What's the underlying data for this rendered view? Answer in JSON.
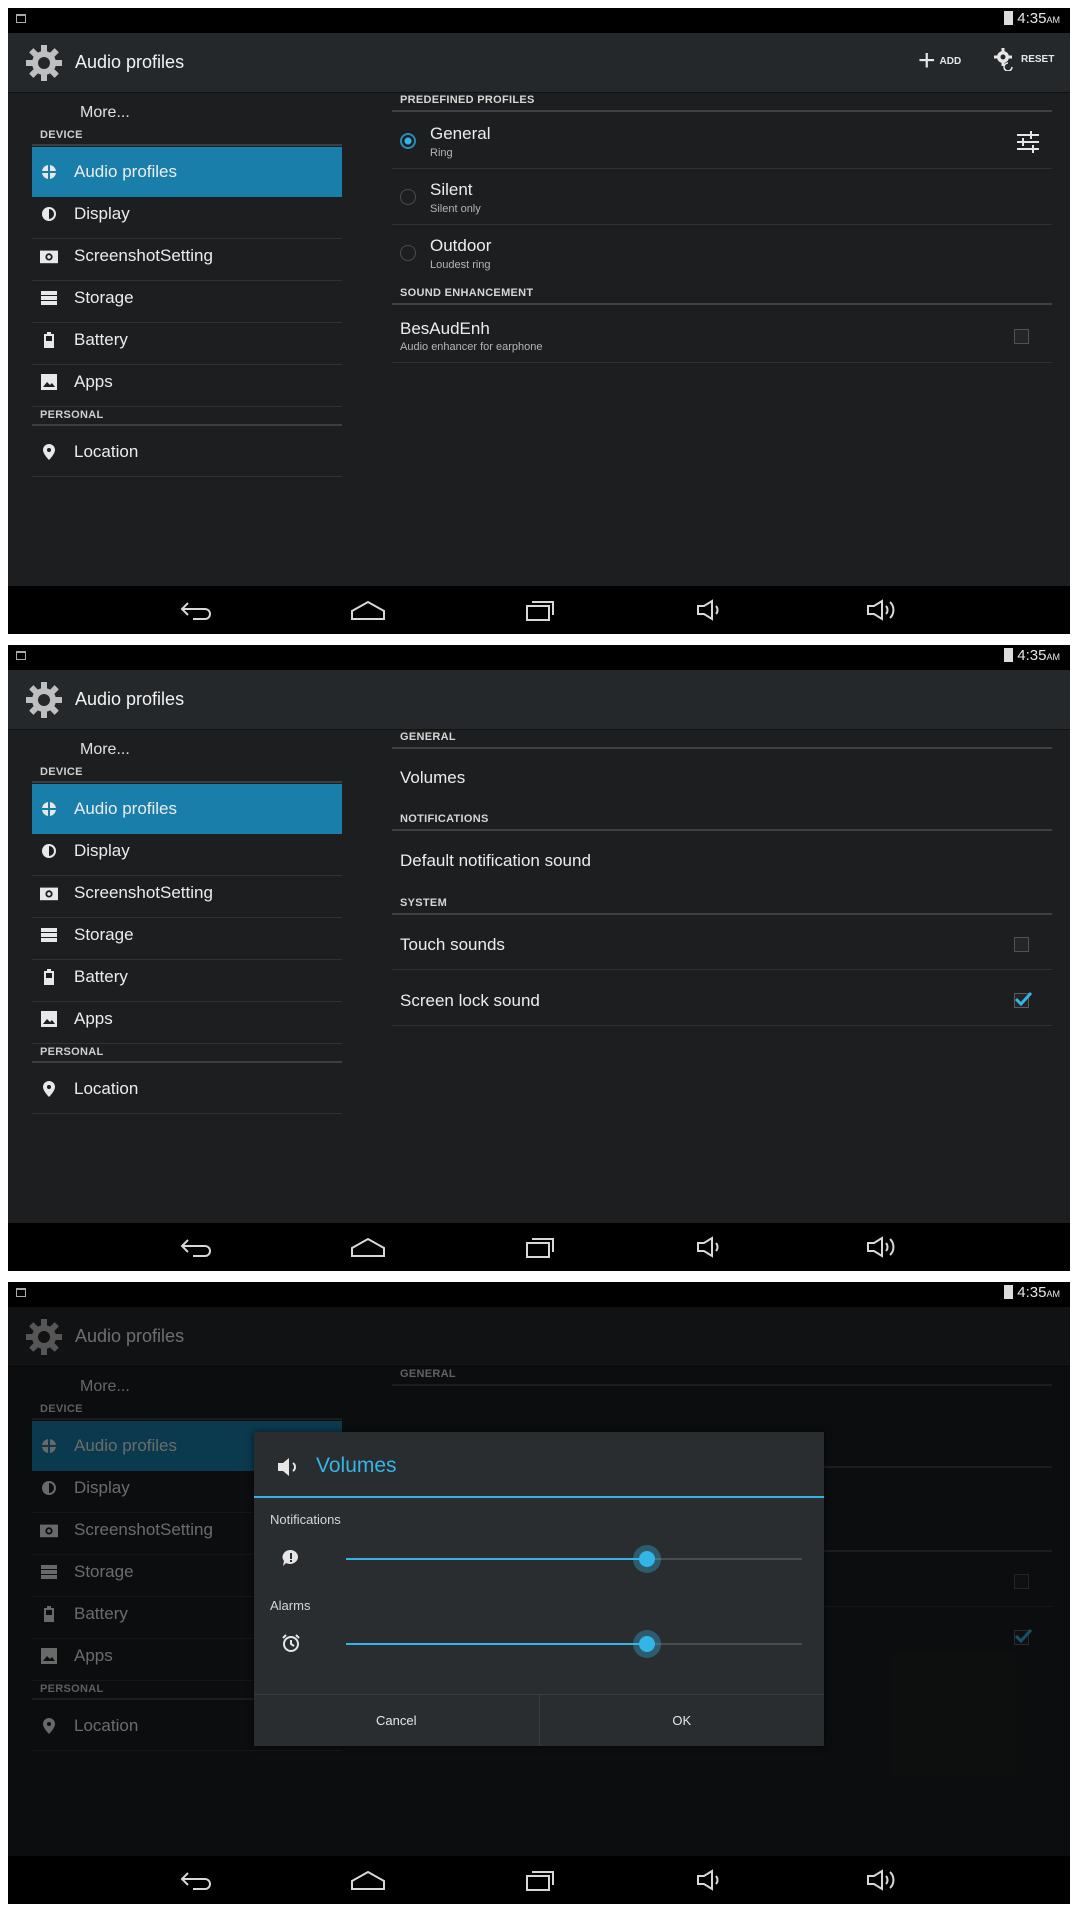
{
  "status_bar": {
    "time": "4:35",
    "ampm": "AM"
  },
  "action_bar": {
    "title": "Audio profiles",
    "add_label": "ADD",
    "reset_label": "RESET"
  },
  "sidebar": {
    "more": "More...",
    "device_header": "DEVICE",
    "personal_header": "PERSONAL",
    "items": [
      {
        "label": "Audio profiles",
        "icon": "audio-profiles-icon",
        "selected": true
      },
      {
        "label": "Display",
        "icon": "display-icon"
      },
      {
        "label": "ScreenshotSetting",
        "icon": "camera-icon"
      },
      {
        "label": "Storage",
        "icon": "storage-icon"
      },
      {
        "label": "Battery",
        "icon": "battery-icon"
      },
      {
        "label": "Apps",
        "icon": "apps-icon"
      }
    ],
    "personal_items": [
      {
        "label": "Location",
        "icon": "location-pin-icon"
      }
    ]
  },
  "profiles": {
    "predefined_header": "PREDEFINED PROFILES",
    "items": [
      {
        "title": "General",
        "subtitle": "Ring",
        "selected": true
      },
      {
        "title": "Silent",
        "subtitle": "Silent only",
        "selected": false
      },
      {
        "title": "Outdoor",
        "subtitle": "Loudest ring",
        "selected": false
      }
    ],
    "enhancement_header": "SOUND ENHANCEMENT",
    "enhancement": {
      "title": "BesAudEnh",
      "subtitle": "Audio enhancer for earphone",
      "checked": false
    }
  },
  "general_settings": {
    "general_header": "GENERAL",
    "volumes": "Volumes",
    "notifications_header": "NOTIFICATIONS",
    "default_notification_sound": "Default notification sound",
    "system_header": "SYSTEM",
    "touch_sounds": {
      "label": "Touch sounds",
      "checked": false
    },
    "screen_lock_sound": {
      "label": "Screen lock sound",
      "checked": true
    }
  },
  "volumes_dialog": {
    "title": "Volumes",
    "notifications_label": "Notifications",
    "notifications_level": 0.66,
    "alarms_label": "Alarms",
    "alarms_level": 0.66,
    "cancel": "Cancel",
    "ok": "OK"
  },
  "colors": {
    "accent": "#33b5e5",
    "selected_bg": "#1a7eab",
    "background": "#1c1e20"
  }
}
